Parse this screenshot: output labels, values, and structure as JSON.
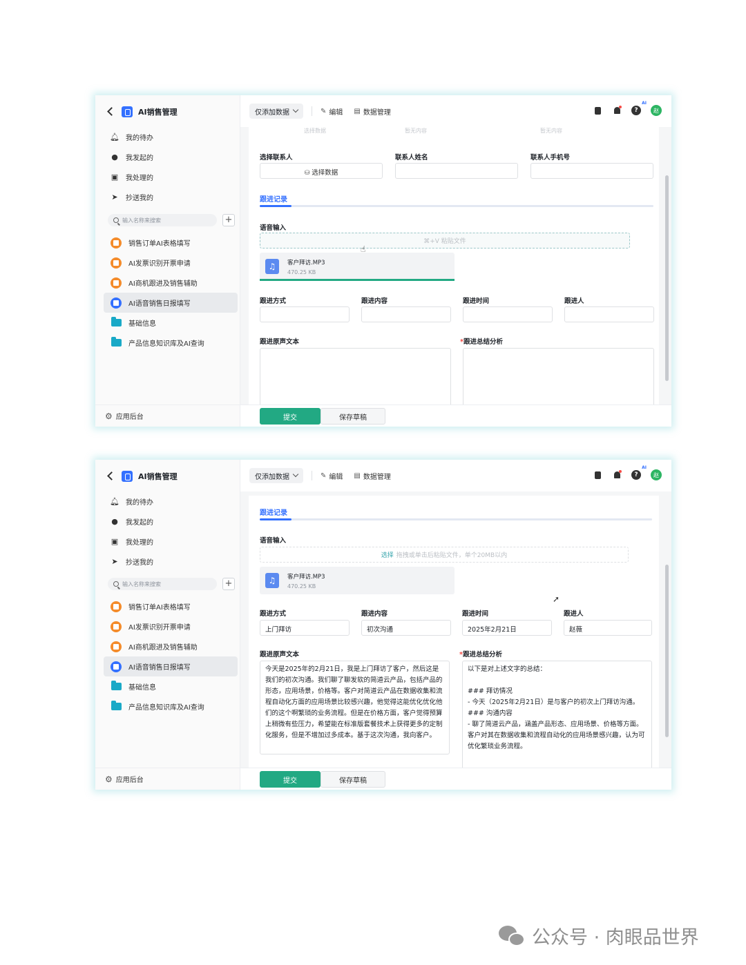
{
  "app": {
    "title": "AI销售管理",
    "mode_select": "仅添加数据",
    "edit_label": "编辑",
    "data_mgmt_label": "数据管理",
    "help_ai_tag": "AI",
    "avatar_text": "赵"
  },
  "sidebar": {
    "nav": [
      {
        "label": "我的待办",
        "icon": "bell-icon"
      },
      {
        "label": "我发起的",
        "icon": "play-circle-icon"
      },
      {
        "label": "我处理的",
        "icon": "inbox-icon"
      },
      {
        "label": "抄送我的",
        "icon": "send-icon"
      }
    ],
    "search_placeholder": "输入名称来搜索",
    "forms": [
      {
        "label": "销售订单AI表格填写",
        "icon": "form-icon"
      },
      {
        "label": "AI发票识别开票申请",
        "icon": "form-icon"
      },
      {
        "label": "AI商机跟进及销售辅助",
        "icon": "form-icon"
      },
      {
        "label": "AI语音销售日报填写",
        "icon": "form-icon",
        "active": true
      },
      {
        "label": "基础信息",
        "icon": "folder-icon"
      },
      {
        "label": "产品信息知识库及AI查询",
        "icon": "folder-icon"
      }
    ],
    "footer": "应用后台"
  },
  "panel1": {
    "clipped_top": [
      "选择数据",
      "暂无内容",
      "暂无内容"
    ],
    "contact_select_label": "选择联系人",
    "contact_select_button": "选择数据",
    "contact_name_label": "联系人姓名",
    "contact_phone_label": "联系人手机号",
    "section_title": "跟进记录",
    "voice_label": "语音输入",
    "dropzone_text": "⌘+V 粘贴文件",
    "file_name": "客户拜访.MP3",
    "file_size": "470.25 KB",
    "upload_progress": 1.0,
    "method_label": "跟进方式",
    "content_label": "跟进内容",
    "time_label": "跟进时间",
    "person_label": "跟进人",
    "transcript_label": "跟进原声文本",
    "summary_label": "跟进总结分析",
    "submit": "提交",
    "save_draft": "保存草稿"
  },
  "panel2": {
    "section_title": "跟进记录",
    "voice_label": "语音输入",
    "dropzone_link": "选择",
    "dropzone_text": "拖拽或单击后粘贴文件，单个20MB以内",
    "file_name": "客户拜访.MP3",
    "file_size": "470.25 KB",
    "method_label": "跟进方式",
    "method_value": "上门拜访",
    "content_label": "跟进内容",
    "content_value": "初次沟通",
    "time_label": "跟进时间",
    "time_value": "2025年2月21日",
    "person_label": "跟进人",
    "person_value": "赵薇",
    "transcript_label": "跟进原声文本",
    "transcript_value": "今天是2025年的2月21日，我是上门拜访了客户，然后这是我们的初次沟通。我们聊了聊发软的简道云产品，包括产品的形态，应用场景，价格等。客户对简道云产品在数据收集和流程自动化方面的应用场景比较感兴趣，他觉得这能优化优化他们的这个啊繁琐的业务流程。但是在价格方面，客户觉得预算上稍微有些压力，希望能在标准版套餐技术上获得更多的定制化服务，但是不增加过多成本。基于这次沟通，我向客户。",
    "summary_label": "跟进总结分析",
    "summary_value": "以下是对上述文字的总结：\n\n### 拜访情况\n- 今天（2025年2月21日）是与客户的初次上门拜访沟通。\n### 沟通内容\n- 聊了简道云产品，涵盖产品形态、应用场景、价格等方面。客户对其在数据收集和流程自动化的应用场景感兴趣，认为可优化繁琐业务流程。",
    "submit": "提交",
    "save_draft": "保存草稿"
  },
  "watermark": "公众号 · 肉眼品世界",
  "colors": {
    "accent": "#3370ff",
    "submit": "#22a983",
    "form_icon": "#f48b2a",
    "folder": "#19a9c7"
  }
}
